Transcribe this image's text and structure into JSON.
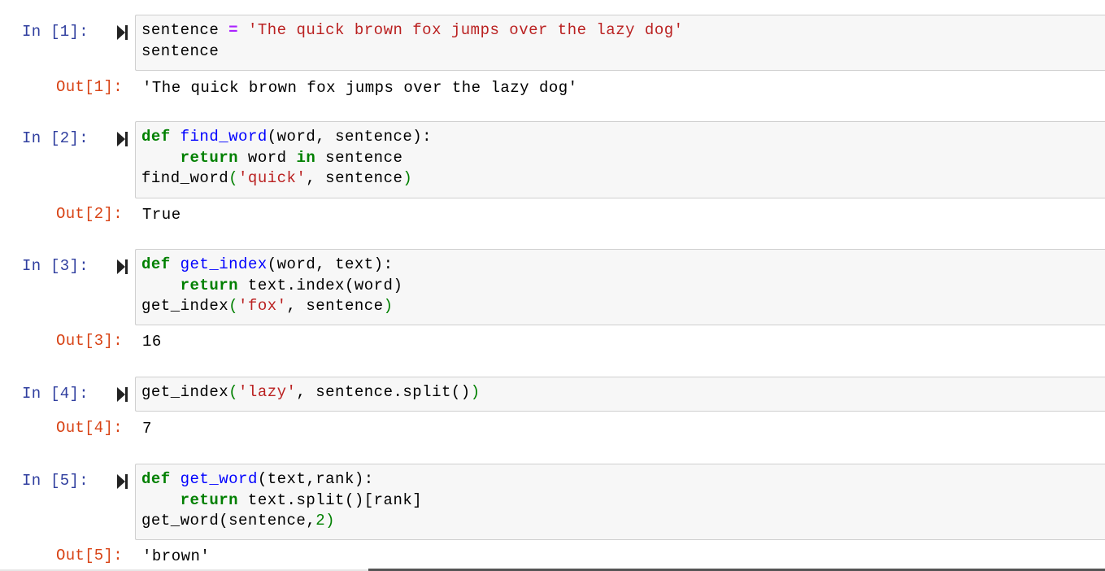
{
  "cells": [
    {
      "in_prompt": "In [1]:",
      "out_prompt": "Out[1]:",
      "output": "'The quick brown fox jumps over the lazy dog'",
      "code": [
        [
          {
            "t": "sentence ",
            "c": ""
          },
          {
            "t": "=",
            "c": "op"
          },
          {
            "t": " ",
            "c": ""
          },
          {
            "t": "'The quick brown fox jumps over the lazy dog'",
            "c": "str"
          }
        ],
        [
          {
            "t": "sentence",
            "c": ""
          }
        ]
      ]
    },
    {
      "in_prompt": "In [2]:",
      "out_prompt": "Out[2]:",
      "output": "True",
      "code": [
        [
          {
            "t": "def",
            "c": "kw"
          },
          {
            "t": " ",
            "c": ""
          },
          {
            "t": "find_word",
            "c": "fn"
          },
          {
            "t": "(word, sentence):",
            "c": ""
          }
        ],
        [
          {
            "t": "    ",
            "c": ""
          },
          {
            "t": "return",
            "c": "kw"
          },
          {
            "t": " word ",
            "c": ""
          },
          {
            "t": "in",
            "c": "kw"
          },
          {
            "t": " sentence",
            "c": ""
          }
        ],
        [
          {
            "t": "find_word",
            "c": ""
          },
          {
            "t": "(",
            "c": "par"
          },
          {
            "t": "'quick'",
            "c": "str"
          },
          {
            "t": ", sentence",
            "c": ""
          },
          {
            "t": ")",
            "c": "par"
          }
        ]
      ]
    },
    {
      "in_prompt": "In [3]:",
      "out_prompt": "Out[3]:",
      "output": "16",
      "code": [
        [
          {
            "t": "def",
            "c": "kw"
          },
          {
            "t": " ",
            "c": ""
          },
          {
            "t": "get_index",
            "c": "fn"
          },
          {
            "t": "(word, text):",
            "c": ""
          }
        ],
        [
          {
            "t": "    ",
            "c": ""
          },
          {
            "t": "return",
            "c": "kw"
          },
          {
            "t": " text.index(word)",
            "c": ""
          }
        ],
        [
          {
            "t": "get_index",
            "c": ""
          },
          {
            "t": "(",
            "c": "par"
          },
          {
            "t": "'fox'",
            "c": "str"
          },
          {
            "t": ", sentence",
            "c": ""
          },
          {
            "t": ")",
            "c": "par"
          }
        ]
      ]
    },
    {
      "in_prompt": "In [4]:",
      "out_prompt": "Out[4]:",
      "output": "7",
      "code": [
        [
          {
            "t": "get_index",
            "c": ""
          },
          {
            "t": "(",
            "c": "par"
          },
          {
            "t": "'lazy'",
            "c": "str"
          },
          {
            "t": ", sentence.split()",
            "c": ""
          },
          {
            "t": ")",
            "c": "par"
          }
        ]
      ]
    },
    {
      "in_prompt": "In [5]:",
      "out_prompt": "Out[5]:",
      "output": "'brown'",
      "code": [
        [
          {
            "t": "def",
            "c": "kw"
          },
          {
            "t": " ",
            "c": ""
          },
          {
            "t": "get_word",
            "c": "fn"
          },
          {
            "t": "(text,rank):",
            "c": ""
          }
        ],
        [
          {
            "t": "    ",
            "c": ""
          },
          {
            "t": "return",
            "c": "kw"
          },
          {
            "t": " text.split()[rank]",
            "c": ""
          }
        ],
        [
          {
            "t": "get_word",
            "c": ""
          },
          {
            "t": "(sentence,",
            "c": ""
          },
          {
            "t": "2",
            "c": "num"
          },
          {
            "t": ")",
            "c": "par"
          }
        ]
      ]
    }
  ],
  "icons": {
    "run": "run-cell-icon"
  },
  "colors": {
    "in_prompt": "#303f9f",
    "out_prompt": "#d84315",
    "keyword": "#008000",
    "string": "#ba2121",
    "function": "#0000ff"
  }
}
